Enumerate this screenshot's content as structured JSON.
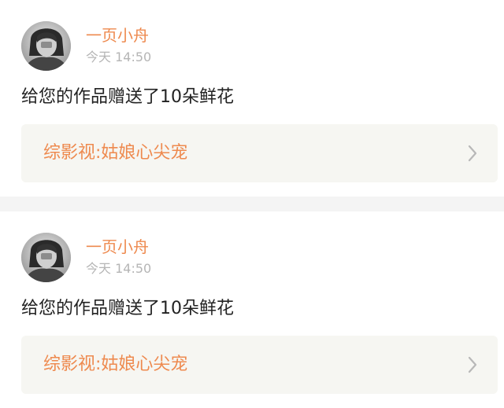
{
  "notifications": [
    {
      "username": "一页小舟",
      "time": "今天 14:50",
      "message": "给您的作品赠送了10朵鲜花",
      "work_title": "综影视:姑娘心尖宠",
      "avatar_icon": "avatar-photo-icon",
      "chevron_icon": "chevron-right-icon"
    },
    {
      "username": "一页小舟",
      "time": "今天 14:50",
      "message": "给您的作品赠送了10朵鲜花",
      "work_title": "综影视:姑娘心尖宠",
      "avatar_icon": "avatar-photo-icon",
      "chevron_icon": "chevron-right-icon"
    }
  ],
  "colors": {
    "accent": "#ee8a4f",
    "time_text": "#b5b5b5",
    "body_text": "#222222",
    "link_background": "#f6f6f2",
    "divider": "#f4f4f4"
  }
}
